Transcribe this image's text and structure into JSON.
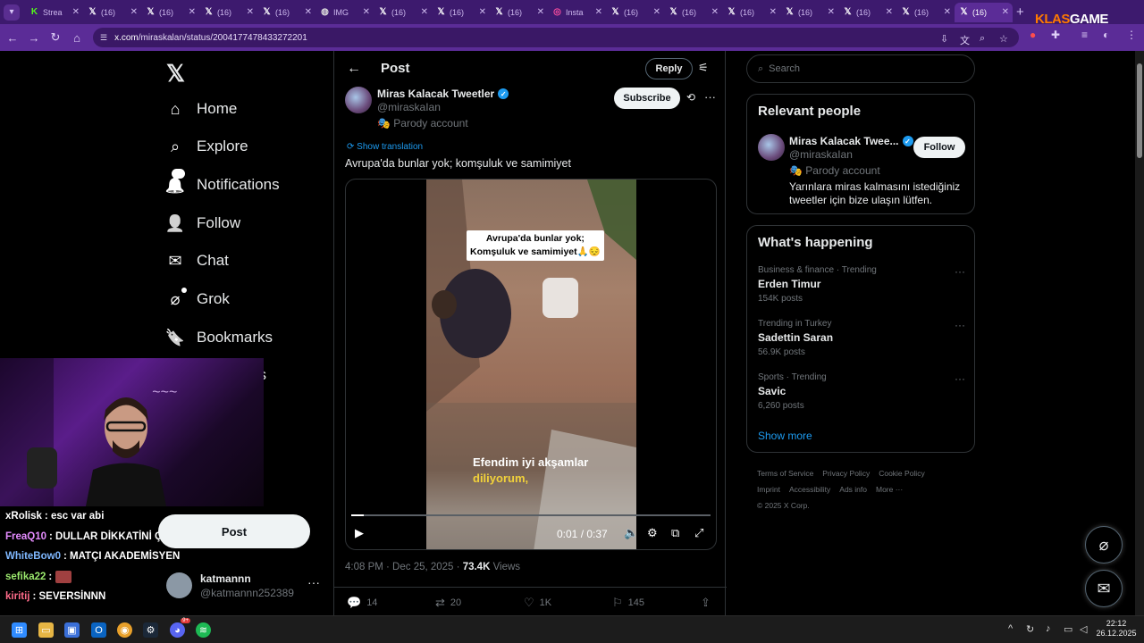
{
  "browser": {
    "tabs": [
      {
        "icon": "kick-icon",
        "label": "Strea"
      },
      {
        "icon": "x-icon",
        "label": "(16)"
      },
      {
        "icon": "x-icon",
        "label": "(16)"
      },
      {
        "icon": "x-icon",
        "label": "(16)"
      },
      {
        "icon": "x-icon",
        "label": "(16)"
      },
      {
        "icon": "globe-icon",
        "label": "IMG"
      },
      {
        "icon": "x-icon",
        "label": "(16)"
      },
      {
        "icon": "x-icon",
        "label": "(16)"
      },
      {
        "icon": "x-icon",
        "label": "(16)"
      },
      {
        "icon": "instagram-icon",
        "label": "Insta"
      },
      {
        "icon": "x-icon",
        "label": "(16)"
      },
      {
        "icon": "x-icon",
        "label": "(16)"
      },
      {
        "icon": "x-icon",
        "label": "(16)"
      },
      {
        "icon": "x-icon",
        "label": "(16)"
      },
      {
        "icon": "x-icon",
        "label": "(16)"
      },
      {
        "icon": "x-icon",
        "label": "(16)"
      },
      {
        "icon": "x-icon",
        "label": "(16)"
      }
    ],
    "url_domain": "x.com",
    "url_path": "/miraskalan/status/2004177478433272201",
    "brand_a": "KLAS",
    "brand_b": "GAME"
  },
  "sidebar": {
    "items": [
      {
        "label": "Home",
        "icon": "home-icon"
      },
      {
        "label": "Explore",
        "icon": "search-icon"
      },
      {
        "label": "Notifications",
        "icon": "bell-icon",
        "badge": "16"
      },
      {
        "label": "Follow",
        "icon": "follow-icon"
      },
      {
        "label": "Chat",
        "icon": "mail-icon"
      },
      {
        "label": "Grok",
        "icon": "grok-icon"
      },
      {
        "label": "Bookmarks",
        "icon": "bookmark-icon"
      }
    ],
    "partial_label": "es",
    "post_button": "Post",
    "account": {
      "name": "katmannn",
      "handle": "@katmannn252389"
    }
  },
  "stream_chat": [
    {
      "user": "xRolisk",
      "color": "#ffffff",
      "message": ": esc var abi"
    },
    {
      "user": "FreaQ10",
      "color": "#e58cff",
      "message": ": DULLAR DİKKATİNİ ÇEKTİ"
    },
    {
      "user": "WhiteBow0",
      "color": "#7fb8ff",
      "message": ": MATÇI AKADEMİSYEN"
    },
    {
      "user": "sefika22",
      "color": "#9be86d",
      "message": ":"
    },
    {
      "user": "kiritij",
      "color": "#ff6b8a",
      "message": ": SEVERSİNNN"
    }
  ],
  "post": {
    "header_title": "Post",
    "reply_label": "Reply",
    "author_name": "Miras Kalacak Tweetler",
    "author_handle": "@miraskaIan",
    "parody": "Parody account",
    "subscribe_label": "Subscribe",
    "translate_label": "Show translation",
    "text": "Avrupa'da bunlar yok; komşuluk ve samimiyet",
    "video": {
      "caption_top_1": "Avrupa'da bunlar yok;",
      "caption_top_2": "Komşuluk ve samimiyet🙏😔",
      "caption_bottom_1": "Efendim iyi akşamlar",
      "caption_bottom_2": "diliyorum,",
      "time": "0:01 / 0:37",
      "progress": 0.035
    },
    "timestamp": "4:08 PM · Dec 25, 2025 · ",
    "views_count": "73.4K",
    "views_label": " Views",
    "replies": "14",
    "reposts": "20",
    "likes": "1K",
    "bookmarks": "145"
  },
  "right": {
    "search_placeholder": "Search",
    "relevant_title": "Relevant people",
    "relevant": {
      "name": "Miras Kalacak Twee...",
      "handle": "@miraskaIan",
      "parody": "Parody account",
      "bio": "Yarınlara miras kalmasını istediğiniz tweetler için bize ulaşın lütfen.",
      "follow_label": "Follow"
    },
    "happening_title": "What's happening",
    "trends": [
      {
        "category": "Business & finance · Trending",
        "name": "Erden Timur",
        "count": "154K posts"
      },
      {
        "category": "Trending in Turkey",
        "name": "Sadettin Saran",
        "count": "56.9K posts"
      },
      {
        "category": "Sports · Trending",
        "name": "Savic",
        "count": "6,260 posts"
      }
    ],
    "show_more": "Show more",
    "footer": [
      "Terms of Service",
      "Privacy Policy",
      "Cookie Policy",
      "Imprint",
      "Accessibility",
      "Ads info",
      "More ···",
      "© 2025 X Corp."
    ]
  },
  "taskbar": {
    "time": "22:12",
    "date": "26.12.2025",
    "discord_badge": "9+"
  },
  "colors": {
    "accent": "#1d9bf0",
    "browser_purple": "#5b2c97",
    "background": "#000000"
  }
}
